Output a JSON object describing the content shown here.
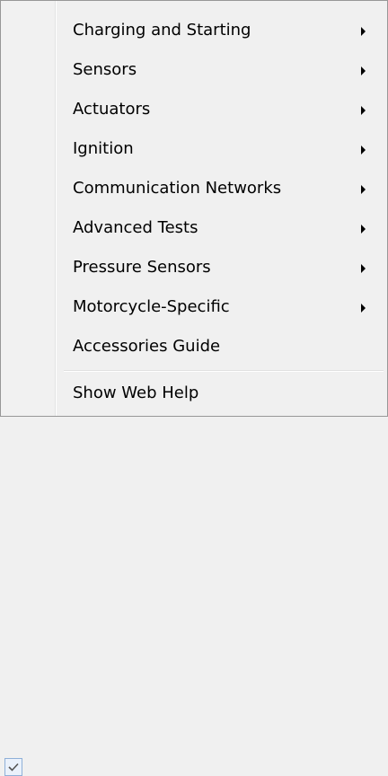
{
  "menu": {
    "items": [
      {
        "label": "Charging and Starting",
        "submenu": true
      },
      {
        "label": "Sensors",
        "submenu": true
      },
      {
        "label": "Actuators",
        "submenu": true
      },
      {
        "label": "Ignition",
        "submenu": true
      },
      {
        "label": "Communication Networks",
        "submenu": true
      },
      {
        "label": "Advanced Tests",
        "submenu": true
      },
      {
        "label": "Pressure Sensors",
        "submenu": true
      },
      {
        "label": "Motorcycle-Specific",
        "submenu": true
      },
      {
        "label": "Accessories Guide",
        "submenu": false
      }
    ],
    "checked_item": {
      "label": "Show Web Help",
      "checked": true,
      "icon": "checkmark-icon"
    },
    "submenu_icon": "submenu-arrow-icon",
    "colors": {
      "background": "#f0f0f0",
      "text": "#000000",
      "border": "#979797",
      "check_border": "#8fb0d8",
      "check_fill": "#eaf1fb"
    }
  }
}
